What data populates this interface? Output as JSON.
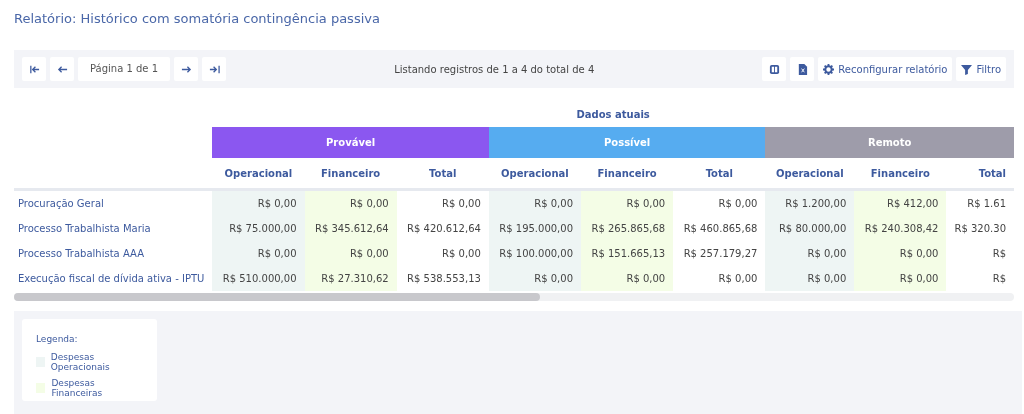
{
  "title": "Relatório: Histórico com somatória contingência passiva",
  "toolbar": {
    "nav_left": [
      {
        "kind": "first"
      },
      {
        "kind": "prev"
      }
    ],
    "page_label": "Página 1 de 1",
    "nav_right": [
      {
        "kind": "next"
      },
      {
        "kind": "last"
      }
    ],
    "status": "Listando registros de 1 a 4 do total de 4",
    "actions": [
      {
        "kind": "columns"
      },
      {
        "kind": "export"
      },
      {
        "kind": "settings",
        "label": "Reconfigurar relatório"
      },
      {
        "kind": "filter",
        "label": "Filtro"
      }
    ]
  },
  "table": {
    "super_header": "Dados atuais",
    "groups": [
      {
        "label": "Provável",
        "color": "#8b57f0",
        "columns": [
          {
            "label": "Operacional",
            "kind": "operational"
          },
          {
            "label": "Financeiro",
            "kind": "financial"
          },
          {
            "label": "Total",
            "kind": "total"
          }
        ]
      },
      {
        "label": "Possível",
        "color": "#56acf0",
        "columns": [
          {
            "label": "Operacional",
            "kind": "operational"
          },
          {
            "label": "Financeiro",
            "kind": "financial"
          },
          {
            "label": "Total",
            "kind": "total"
          }
        ]
      },
      {
        "label": "Remoto",
        "color": "#9e9caa",
        "columns": [
          {
            "label": "Operacional",
            "kind": "operational"
          },
          {
            "label": "Financeiro",
            "kind": "financial"
          },
          {
            "label": "Total",
            "kind": "total"
          }
        ]
      }
    ],
    "rows": [
      {
        "label": "Procuração Geral",
        "cells": [
          "R$ 0,00",
          "R$ 0,00",
          "R$ 0,00",
          "R$ 0,00",
          "R$ 0,00",
          "R$ 0,00",
          "R$ 1.200,00",
          "R$ 412,00",
          "R$ 1.61"
        ]
      },
      {
        "label": "Processo Trabalhista Maria",
        "cells": [
          "R$ 75.000,00",
          "R$ 345.612,64",
          "R$ 420.612,64",
          "R$ 195.000,00",
          "R$ 265.865,68",
          "R$ 460.865,68",
          "R$ 80.000,00",
          "R$ 240.308,42",
          "R$ 320.30"
        ]
      },
      {
        "label": "Processo Trabalhista AAA",
        "cells": [
          "R$ 0,00",
          "R$ 0,00",
          "R$ 0,00",
          "R$ 100.000,00",
          "R$ 151.665,13",
          "R$ 257.179,27",
          "R$ 0,00",
          "R$ 0,00",
          "R$"
        ]
      },
      {
        "label": "Execução fiscal de dívida ativa - IPTU",
        "cells": [
          "R$ 510.000,00",
          "R$ 27.310,62",
          "R$ 538.553,13",
          "R$ 0,00",
          "R$ 0,00",
          "R$ 0,00",
          "R$ 0,00",
          "R$ 0,00",
          "R$"
        ]
      }
    ]
  },
  "legend": {
    "title": "Legenda:",
    "items": [
      {
        "label": "Despesas Operacionais",
        "color": "#eef5f4"
      },
      {
        "label": "Despesas Financeiras",
        "color": "#f4fde6"
      }
    ]
  }
}
